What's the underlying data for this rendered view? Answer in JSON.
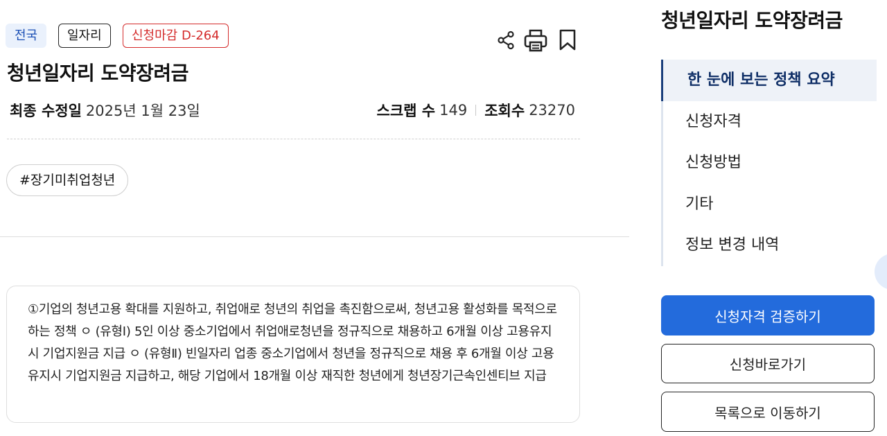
{
  "badges": {
    "region": "전국",
    "category": "일자리",
    "deadline": "신청마감 D-264"
  },
  "actions": {
    "share_icon": "share-icon",
    "print_icon": "printer-icon",
    "bookmark_icon": "bookmark-icon"
  },
  "policy": {
    "title": "청년일자리 도약장려금",
    "updated_label": "최종 수정일",
    "updated_value": "2025년 1월 23일",
    "scrap_label": "스크랩 수",
    "scrap_value": "149",
    "views_label": "조회수",
    "views_value": "23270",
    "hashtag": "#장기미취업청년",
    "summary": "①기업의 청년고용 확대를 지원하고, 취업애로 청년의 취업을 촉진함으로써, 청년고용 활성화를 목적으로 하는 정책 ㅇ (유형Ⅰ) 5인 이상 중소기업에서 취업애로청년을 정규직으로 채용하고 6개월 이상 고용유지시 기업지원금 지급 ㅇ (유형Ⅱ) 빈일자리 업종 중소기업에서 청년을 정규직으로 채용 후 6개월 이상 고용유지시 기업지원금 지급하고, 해당 기업에서 18개월 이상 재직한 청년에게 청년장기근속인센티브 지급"
  },
  "sidebar": {
    "title": "청년일자리 도약장려금",
    "toc": [
      {
        "label": "한 눈에 보는 정책 요약",
        "active": true
      },
      {
        "label": "신청자격",
        "active": false
      },
      {
        "label": "신청방법",
        "active": false
      },
      {
        "label": "기타",
        "active": false
      },
      {
        "label": "정보 변경 내역",
        "active": false
      }
    ],
    "verify_button": "신청자격 검증하기",
    "apply_button": "신청바로가기",
    "list_button": "목록으로 이동하기"
  },
  "colors": {
    "primary": "#236bdc",
    "deadline_red": "#d42a2a",
    "region_bg": "#eaf1fc",
    "toc_active": "#1a3f7c"
  }
}
